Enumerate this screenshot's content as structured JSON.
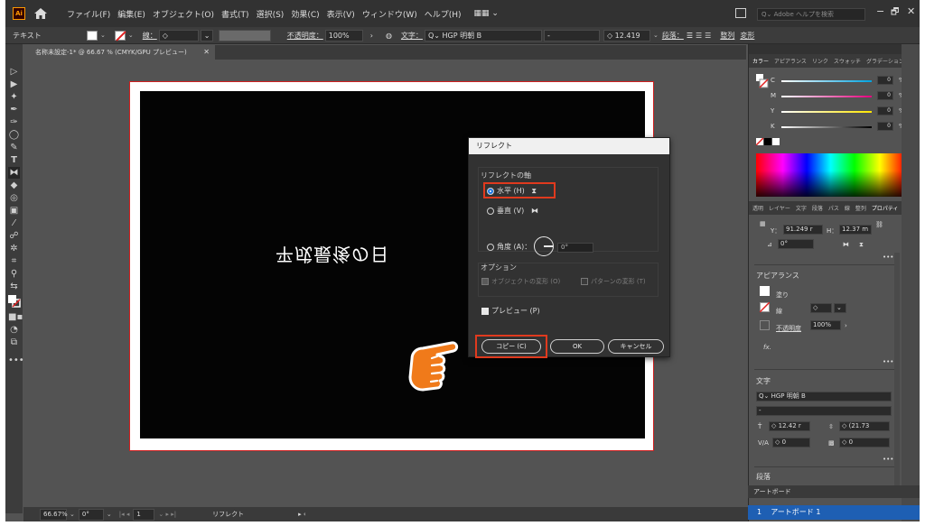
{
  "menubar": {
    "logo": "Ai",
    "items": [
      "ファイル(F)",
      "編集(E)",
      "オブジェクト(O)",
      "書式(T)",
      "選択(S)",
      "効果(C)",
      "表示(V)",
      "ウィンドウ(W)",
      "ヘルプ(H)"
    ],
    "workspace": "▦▦ ⌄",
    "search_placeholder": "Adobe ヘルプを検索",
    "minimize": "−",
    "restore": "🗗",
    "close": "✕"
  },
  "controlbar": {
    "type_label": "テキスト",
    "stroke_label": "線：",
    "opacity_label": "不透明度：",
    "opacity_value": "100%",
    "char_label": "文字：",
    "font": "HGP 明朝 B",
    "font_size": "12.419",
    "para_label": "段落：",
    "align_label": "整列",
    "transform_label": "変形"
  },
  "document": {
    "tab": "名称未設定-1* @ 66.67 % (CMYK/GPU プレビュー)",
    "tab_close": "✕",
    "art_text": "平成最後の日",
    "zoom": "66.67%",
    "rotation": "0°",
    "artboard_num": "1",
    "status_text": "リフレクト"
  },
  "dialog": {
    "title": "リフレクト",
    "axis_group": "リフレクトの軸",
    "horizontal": "水平 (H)",
    "vertical": "垂直 (V)",
    "angle": "角度 (A)：",
    "angle_value": "0°",
    "options_group": "オプション",
    "transform_objects": "オブジェクトの変形 (O)",
    "transform_patterns": "パターンの変形 (T)",
    "preview": "プレビュー (P)",
    "copy_button": "コピー (C)",
    "ok_button": "OK",
    "cancel_button": "キャンセル"
  },
  "color_panel": {
    "tabs": [
      "カラー",
      "アピアランス",
      "リンク",
      "スウォッチ",
      "グラデーション"
    ],
    "c_label": "C",
    "m_label": "M",
    "y_label": "Y",
    "k_label": "K",
    "c_value": "0",
    "m_value": "0",
    "y_value": "0",
    "k_value": "0",
    "percent": "%"
  },
  "properties_panel": {
    "tabs": [
      "透明",
      "レイヤー",
      "文字",
      "段落",
      "パス",
      "線",
      "整列",
      "プロパティ"
    ],
    "y_label": "Y：",
    "y_value": "91.249 r",
    "h_label": "H：",
    "h_value": "12.37 m",
    "rotate_value": "0°",
    "appearance_title": "アピアランス",
    "fill_label": "塗り",
    "stroke_label": "線",
    "opacity_label": "不透明度",
    "opacity_value": "100%",
    "fx_label": "fx.",
    "text_title": "文字",
    "font": "HGP 明朝 B",
    "font_style": "-",
    "size_value": "12.42 r",
    "leading_value": "(21.73",
    "tracking_value": "0",
    "kerning_value": "0",
    "paragraph_title": "段落",
    "more": "•••"
  },
  "artboards_panel": {
    "title": "アートボード",
    "row_num": "1",
    "row_name": "アートボード 1"
  },
  "colors": {
    "highlight": "#e03a1e",
    "selection_blue": "#1e5fb3",
    "hand_orange": "#f07a1a"
  }
}
